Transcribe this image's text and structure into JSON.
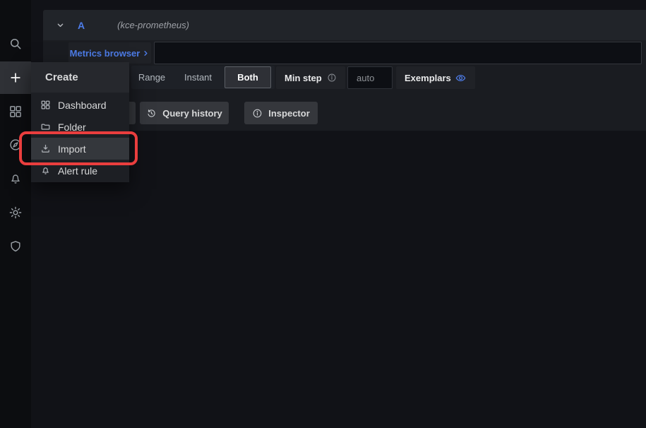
{
  "app": "grafana-explore",
  "sidebar": {
    "icons": [
      {
        "name": "search"
      },
      {
        "name": "create-plus",
        "active": true
      },
      {
        "name": "dashboards"
      },
      {
        "name": "explore-compass"
      },
      {
        "name": "alerting-bell"
      },
      {
        "name": "configuration-gear"
      },
      {
        "name": "admin-shield"
      }
    ]
  },
  "create_menu": {
    "title": "Create",
    "items": [
      {
        "label": "Dashboard",
        "icon": "apps-icon"
      },
      {
        "label": "Folder",
        "icon": "folder-icon"
      },
      {
        "label": "Import",
        "icon": "import-icon",
        "highlighted": true,
        "annotated": true
      },
      {
        "label": "Alert rule",
        "icon": "bell-icon"
      }
    ]
  },
  "query_editor": {
    "ref_id": "A",
    "datasource_hint": "(kce-prometheus)",
    "metrics_browser_label": "Metrics browser",
    "expression_value": "",
    "options": {
      "query_type_options": [
        "Range",
        "Instant",
        "Both"
      ],
      "query_type_selected": "Both",
      "min_step_label": "Min step",
      "min_step_value": "auto",
      "exemplars_label": "Exemplars"
    },
    "toolbar": {
      "query_history_label": "Query history",
      "inspector_label": "Inspector"
    }
  },
  "annotation": {
    "shape": "rounded-rectangle",
    "target": "Import menu item",
    "color": "#ea3e3e"
  },
  "colors": {
    "accent_blue": "#4d7ce8",
    "annotation_red": "#ea3e3e",
    "page_bg": "#111217",
    "panel_bg": "#1a1c21"
  }
}
